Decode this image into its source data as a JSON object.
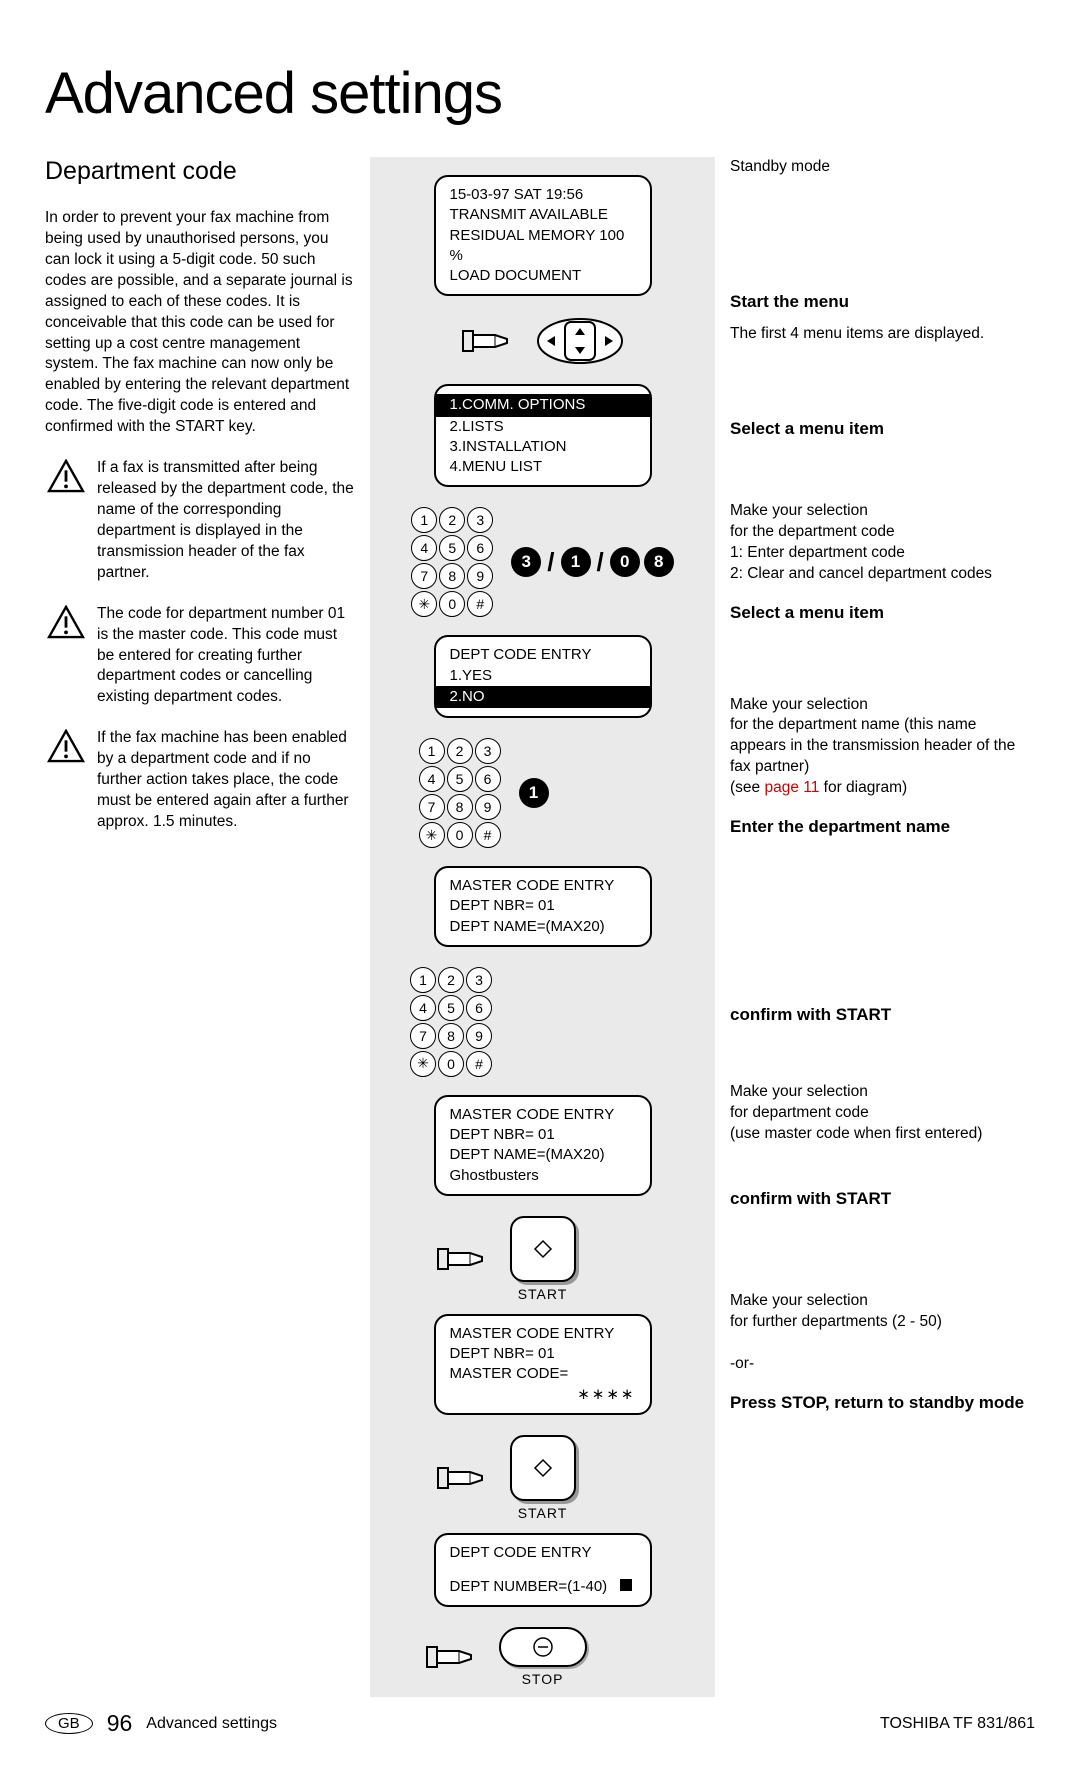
{
  "title": "Advanced settings",
  "subtitle": "Department code",
  "left": {
    "intro": "In order to prevent your fax machine from being used by unauthorised persons, you can lock it using a 5-digit code. 50 such codes are possible, and a separate journal is assigned to each of these codes. It is conceivable that this code can be used for setting up a cost centre management system. The fax machine can now only be enabled by entering the relevant department code. The five-digit code is entered and confirmed with the START key.",
    "warn1": "If a fax is transmitted after being released by the department code, the name of the corresponding department is displayed in the transmission header of the fax partner.",
    "warn2": "The code for department number 01 is the master code. This code must be entered for creating further department codes or cancelling existing department codes.",
    "warn3": "If the fax machine has been enabled by a department code and if no further action takes place, the code must be entered again after a further approx. 1.5 minutes."
  },
  "display1": {
    "l1": "15-03-97   SAT   19:56",
    "l2": "TRANSMIT AVAILABLE",
    "l3": "RESIDUAL MEMORY 100 %",
    "l4": "LOAD DOCUMENT"
  },
  "display2": {
    "l1": "1.COMM. OPTIONS",
    "l2": "2.LISTS",
    "l3": "3.INSTALLATION",
    "l4": "4.MENU LIST"
  },
  "display3": {
    "l1": "DEPT CODE ENTRY",
    "l2": "1.YES",
    "l3": "2.NO"
  },
  "display4": {
    "l1": "MASTER CODE ENTRY",
    "l2": "DEPT NBR=          01",
    "l3": "DEPT NAME=(MAX20)"
  },
  "display5": {
    "l1": "MASTER CODE ENTRY",
    "l2": "DEPT NBR=          01",
    "l3": "DEPT NAME=(MAX20)",
    "l4": "Ghostbusters"
  },
  "display6": {
    "l1": "MASTER CODE ENTRY",
    "l2": "DEPT NBR=           01",
    "l3": "MASTER CODE=",
    "l4": "∗∗∗∗"
  },
  "display7": {
    "l1": "DEPT CODE ENTRY",
    "l2": "DEPT NUMBER=(1-40)"
  },
  "keys_seq1": [
    "3",
    "1",
    "0",
    "8"
  ],
  "btn_start_label": "START",
  "btn_stop_label": "STOP",
  "right": {
    "standby": "Standby mode",
    "h1": "Start the menu",
    "b1": "The first 4 menu items are displayed.",
    "h2": "Select a menu item",
    "b2a": "Make your selection",
    "b2b": "for the department code",
    "b2c": "1: Enter department code",
    "b2d": "2: Clear and cancel department codes",
    "h3": "Select a menu item",
    "b3a": "Make your selection",
    "b3b": "for the department name (this name appears in the transmission header of the fax partner)",
    "b3c_pre": "(see ",
    "b3c_link": "page 11",
    "b3c_post": " for diagram)",
    "h4": "Enter the department name",
    "h5": "confirm with START",
    "b5a": "Make your selection",
    "b5b": "for department code",
    "b5c": "(use master code when first entered)",
    "h6": "confirm with START",
    "b6a": "Make your selection",
    "b6b": "for further departments (2 - 50)",
    "b6c": "-or-",
    "h7": "Press STOP, return to standby mode"
  },
  "footer": {
    "gb": "GB",
    "page": "96",
    "section": "Advanced settings",
    "model": "TOSHIBA  TF 831/861"
  }
}
